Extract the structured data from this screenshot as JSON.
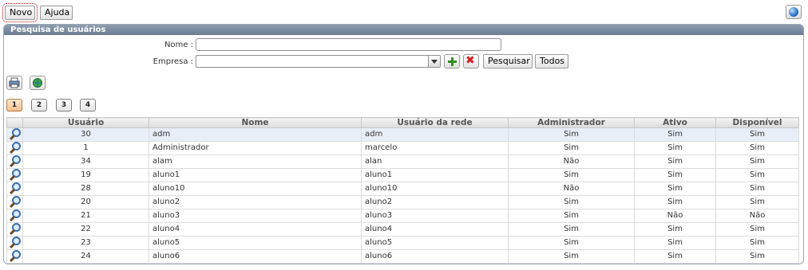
{
  "toolbar": {
    "new_label": "Novo",
    "help_label": "Ajuda"
  },
  "panel": {
    "title": "Pesquisa de usuários"
  },
  "form": {
    "name_label": "Nome :",
    "name_value": "",
    "company_label": "Empresa :",
    "company_value": "",
    "search_label": "Pesquisar",
    "all_label": "Todos"
  },
  "pagination": {
    "pages": [
      "1",
      "2",
      "3",
      "4"
    ],
    "active": "1"
  },
  "table": {
    "headers": [
      "Usuário",
      "Nome",
      "Usuário da rede",
      "Administrador",
      "Ativo",
      "Disponível"
    ],
    "rows": [
      [
        "30",
        "adm",
        "adm",
        "Sim",
        "Sim",
        "Sim"
      ],
      [
        "1",
        "Administrador",
        "marcelo",
        "Sim",
        "Sim",
        "Sim"
      ],
      [
        "34",
        "alam",
        "alan",
        "Não",
        "Sim",
        "Sim"
      ],
      [
        "19",
        "aluno1",
        "aluno1",
        "Sim",
        "Sim",
        "Sim"
      ],
      [
        "28",
        "aluno10",
        "aluno10",
        "Não",
        "Sim",
        "Sim"
      ],
      [
        "20",
        "aluno2",
        "aluno2",
        "Sim",
        "Sim",
        "Sim"
      ],
      [
        "21",
        "aluno3",
        "aluno3",
        "Sim",
        "Não",
        "Não"
      ],
      [
        "22",
        "aluno4",
        "aluno4",
        "Sim",
        "Sim",
        "Sim"
      ],
      [
        "23",
        "aluno5",
        "aluno5",
        "Sim",
        "Sim",
        "Sim"
      ],
      [
        "24",
        "aluno6",
        "aluno6",
        "Sim",
        "Sim",
        "Sim"
      ]
    ]
  },
  "icons": {
    "view": "magnifier-icon",
    "print": "printer-icon",
    "export": "globe-icon",
    "help": "globe-help-icon",
    "add": "add-icon",
    "clear": "clear-icon"
  }
}
